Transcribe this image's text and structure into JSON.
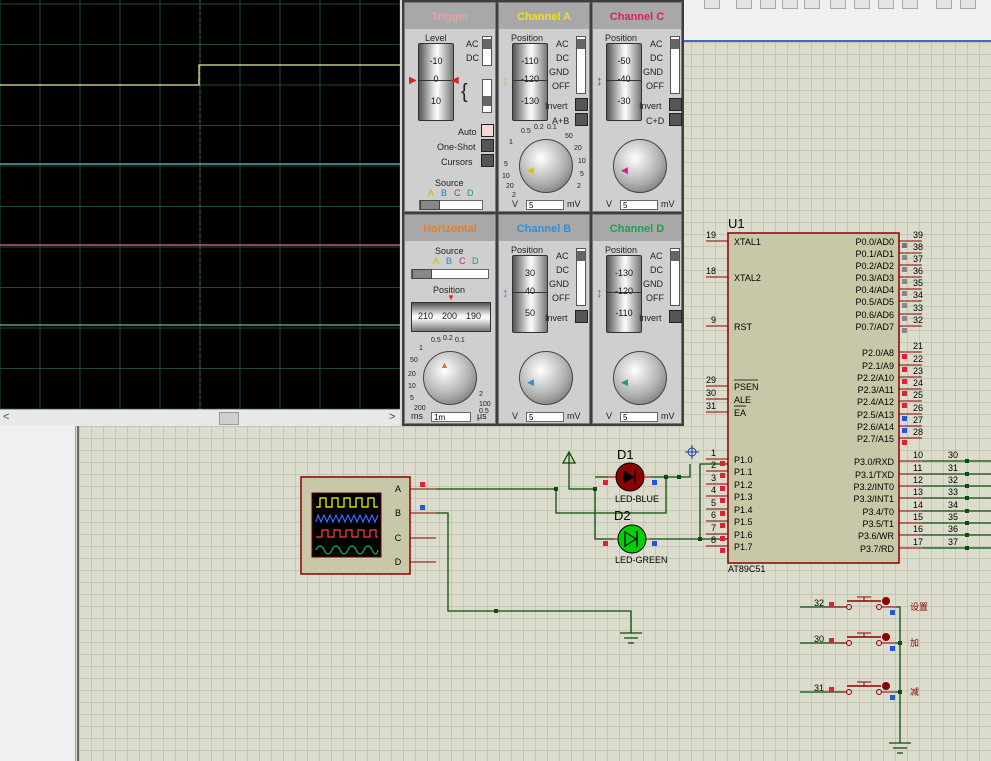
{
  "oscilloscope": {
    "trigger": {
      "title": "Trigger",
      "level_label": "Level",
      "level_ticks": [
        "-10",
        "0",
        "10"
      ],
      "ac": "AC",
      "dc": "DC",
      "auto": "Auto",
      "one_shot": "One-Shot",
      "cursors": "Cursors",
      "source": "Source",
      "source_letters": [
        "A",
        "B",
        "C",
        "D"
      ]
    },
    "channel_a": {
      "title": "Channel A",
      "position": "Position",
      "ticks": [
        "-110",
        "-120",
        "-130"
      ],
      "couplings": [
        "AC",
        "DC",
        "GND",
        "OFF"
      ],
      "invert": "Invert",
      "aux": "A+B",
      "knob_ticks": [
        "0.5",
        "0.2",
        "0.1",
        "1",
        "50",
        "20",
        "10",
        "5",
        "2",
        "5",
        "10",
        "20",
        "2",
        "1"
      ],
      "unit_left": "V",
      "unit_value": "5",
      "unit_right": "mV"
    },
    "channel_c": {
      "title": "Channel C",
      "position": "Position",
      "ticks": [
        "-50",
        "-40",
        "-30"
      ],
      "couplings": [
        "AC",
        "DC",
        "GND",
        "OFF"
      ],
      "invert": "Invert",
      "aux": "C+D",
      "unit_left": "V",
      "unit_value": "5",
      "unit_right": "mV"
    },
    "horizontal": {
      "title": "Horizontal",
      "source": "Source",
      "source_letters": [
        "A",
        "B",
        "C",
        "D"
      ],
      "position": "Position",
      "ticks": [
        "210",
        "200",
        "190"
      ],
      "knob_ticks": [
        "0.5",
        "0.2",
        "0.1",
        "1",
        "50",
        "20",
        "10",
        "5",
        "2",
        "200",
        "100",
        "0.5"
      ],
      "unit_left": "ms",
      "unit_value": "1m",
      "unit_right": "µs"
    },
    "channel_b": {
      "title": "Channel B",
      "position": "Position",
      "ticks": [
        "30",
        "40",
        "50"
      ],
      "couplings": [
        "AC",
        "DC",
        "GND",
        "OFF"
      ],
      "invert": "Invert",
      "unit_left": "V",
      "unit_value": "5",
      "unit_right": "mV"
    },
    "channel_d": {
      "title": "Channel D",
      "position": "Position",
      "ticks": [
        "-130",
        "-120",
        "-110"
      ],
      "couplings": [
        "AC",
        "DC",
        "GND",
        "OFF"
      ],
      "invert": "Invert",
      "unit_left": "V",
      "unit_value": "5",
      "unit_right": "mV"
    }
  },
  "schematic": {
    "mcu": {
      "ref": "U1",
      "part": "AT89C51",
      "left_pins": [
        {
          "num": "19",
          "name": "XTAL1"
        },
        {
          "num": "18",
          "name": "XTAL2"
        },
        {
          "num": "9",
          "name": "RST"
        },
        {
          "num": "29",
          "name": "PSEN"
        },
        {
          "num": "30",
          "name": "ALE"
        },
        {
          "num": "31",
          "name": "EA"
        },
        {
          "num": "1",
          "name": "P1.0"
        },
        {
          "num": "2",
          "name": "P1.1"
        },
        {
          "num": "3",
          "name": "P1.2"
        },
        {
          "num": "4",
          "name": "P1.3"
        },
        {
          "num": "5",
          "name": "P1.4"
        },
        {
          "num": "6",
          "name": "P1.5"
        },
        {
          "num": "7",
          "name": "P1.6"
        },
        {
          "num": "8",
          "name": "P1.7"
        }
      ],
      "right_pins": [
        {
          "num": "39",
          "name": "P0.0/AD0"
        },
        {
          "num": "38",
          "name": "P0.1/AD1"
        },
        {
          "num": "37",
          "name": "P0.2/AD2"
        },
        {
          "num": "36",
          "name": "P0.3/AD3"
        },
        {
          "num": "35",
          "name": "P0.4/AD4"
        },
        {
          "num": "34",
          "name": "P0.5/AD5"
        },
        {
          "num": "33",
          "name": "P0.6/AD6"
        },
        {
          "num": "32",
          "name": "P0.7/AD7"
        },
        {
          "num": "21",
          "name": "P2.0/A8"
        },
        {
          "num": "22",
          "name": "P2.1/A9"
        },
        {
          "num": "23",
          "name": "P2.2/A10"
        },
        {
          "num": "24",
          "name": "P2.3/A11"
        },
        {
          "num": "25",
          "name": "P2.4/A12"
        },
        {
          "num": "26",
          "name": "P2.5/A13"
        },
        {
          "num": "27",
          "name": "P2.6/A14"
        },
        {
          "num": "28",
          "name": "P2.7/A15"
        },
        {
          "num": "10",
          "name": "P3.0/RXD"
        },
        {
          "num": "11",
          "name": "P3.1/TXD"
        },
        {
          "num": "12",
          "name": "P3.2/INT0"
        },
        {
          "num": "13",
          "name": "P3.3/INT1"
        },
        {
          "num": "14",
          "name": "P3.4/T0"
        },
        {
          "num": "15",
          "name": "P3.5/T1"
        },
        {
          "num": "16",
          "name": "P3.6/WR"
        },
        {
          "num": "17",
          "name": "P3.7/RD"
        }
      ],
      "p3_net_labels": [
        "30",
        "31",
        "32",
        "33",
        "34",
        "35",
        "36",
        "37"
      ]
    },
    "led1": {
      "ref": "D1",
      "part": "LED-BLUE"
    },
    "led2": {
      "ref": "D2",
      "part": "LED-GREEN"
    },
    "scope_channels": [
      "A",
      "B",
      "C",
      "D"
    ],
    "buttons": [
      {
        "net": "32",
        "label": "设置"
      },
      {
        "net": "30",
        "label": "加"
      },
      {
        "net": "31",
        "label": "减"
      }
    ]
  }
}
